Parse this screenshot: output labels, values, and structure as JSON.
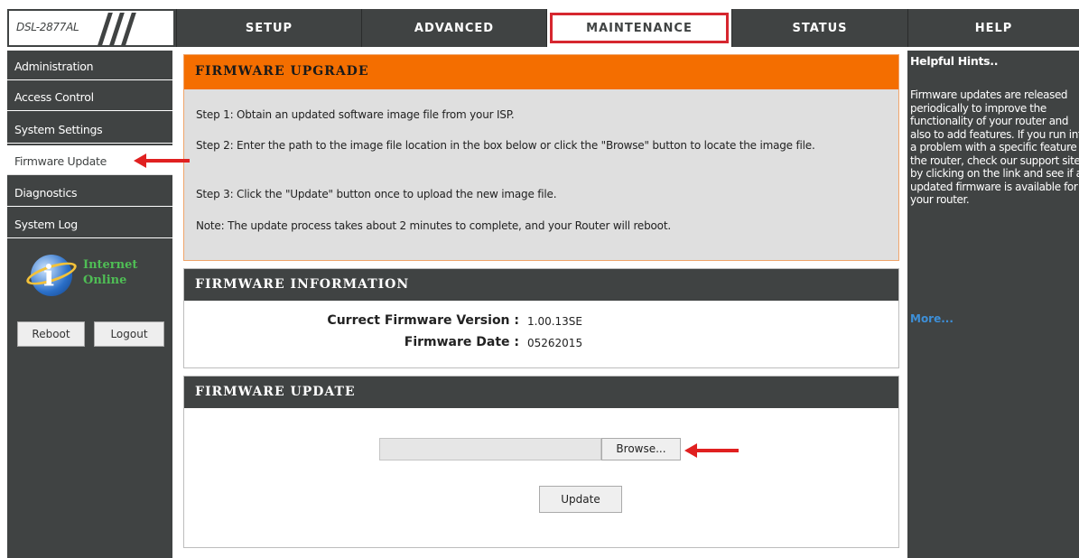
{
  "logo": {
    "model": "DSL-2877AL"
  },
  "nav": {
    "tabs": [
      {
        "label": "SETUP"
      },
      {
        "label": "ADVANCED"
      },
      {
        "label": "MAINTENANCE",
        "active": true
      },
      {
        "label": "STATUS"
      },
      {
        "label": "HELP"
      }
    ]
  },
  "sidebar": {
    "items": [
      {
        "label": "Administration"
      },
      {
        "label": "Access Control"
      },
      {
        "label": "System Settings"
      },
      {
        "label": "Firmware Update",
        "active": true
      },
      {
        "label": "Diagnostics"
      },
      {
        "label": "System Log"
      }
    ],
    "internet_status_line1": "Internet",
    "internet_status_line2": "Online",
    "reboot_label": "Reboot",
    "logout_label": "Logout"
  },
  "upgrade": {
    "title": "FIRMWARE UPGRADE",
    "step1": "Step 1: Obtain an updated software image file from your ISP.",
    "step2": "Step 2: Enter the path to the image file location in the box below or click the \"Browse\" button to locate the image file.",
    "step3": "Step 3: Click the \"Update\" button once to upload the new image file.",
    "note": "Note: The update process takes about 2 minutes to complete, and your Router will reboot."
  },
  "info": {
    "title": "FIRMWARE INFORMATION",
    "version_label": "Currect Firmware Version :",
    "version_value": "1.00.13SE",
    "date_label": "Firmware Date :",
    "date_value": "05262015"
  },
  "update": {
    "title": "FIRMWARE UPDATE",
    "file_value": "",
    "browse_label": "Browse...",
    "update_label": "Update"
  },
  "hints": {
    "title": "Helpful Hints..",
    "body": "Firmware updates are released periodically to improve the functionality of your router and also to add features. If you run into a problem with a specific feature of the router, check our support site by clicking on the link and see if an updated firmware is available for your router.",
    "more_label": "More..."
  },
  "colors": {
    "chrome": "#404343",
    "accent_orange": "#f46e00",
    "active_frame": "#d6262f",
    "status_green": "#4fbe55",
    "annotation_arrow": "#e02020"
  }
}
